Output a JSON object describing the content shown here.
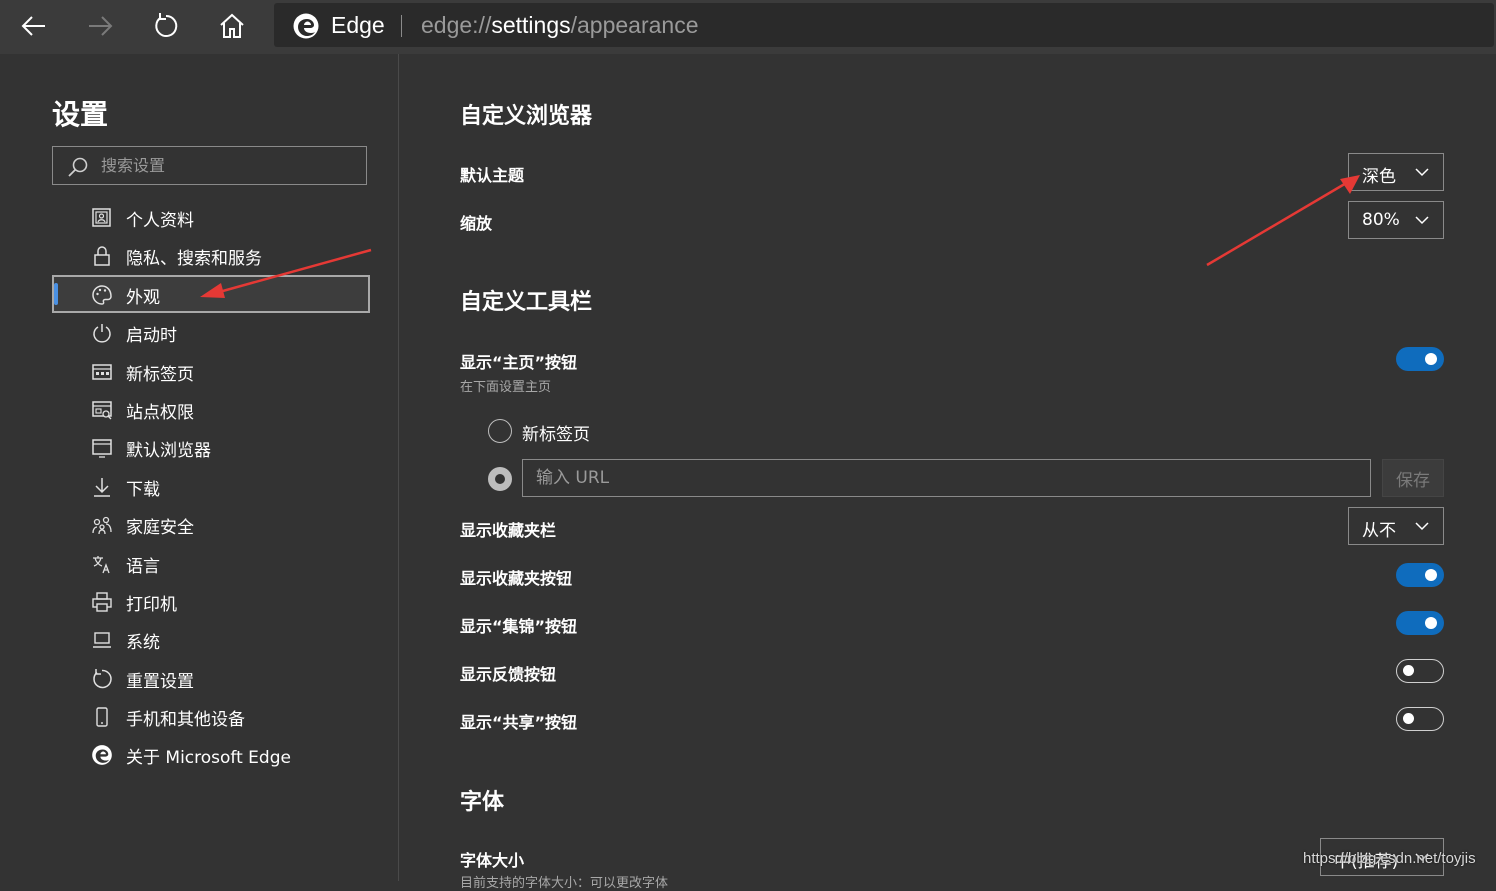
{
  "toolbar": {
    "brand": "Edge",
    "url_prefix": "edge://",
    "url_host": "settings",
    "url_path": "/appearance"
  },
  "sidebar": {
    "title": "设置",
    "search_placeholder": "搜索设置",
    "items": [
      {
        "label": "个人资料",
        "icon": "profile-icon"
      },
      {
        "label": "隐私、搜索和服务",
        "icon": "lock-icon"
      },
      {
        "label": "外观",
        "icon": "palette-icon",
        "active": true
      },
      {
        "label": "启动时",
        "icon": "power-icon"
      },
      {
        "label": "新标签页",
        "icon": "new-tab-icon"
      },
      {
        "label": "站点权限",
        "icon": "site-permissions-icon"
      },
      {
        "label": "默认浏览器",
        "icon": "browser-icon"
      },
      {
        "label": "下载",
        "icon": "download-icon"
      },
      {
        "label": "家庭安全",
        "icon": "family-icon"
      },
      {
        "label": "语言",
        "icon": "language-icon"
      },
      {
        "label": "打印机",
        "icon": "printer-icon"
      },
      {
        "label": "系统",
        "icon": "system-icon"
      },
      {
        "label": "重置设置",
        "icon": "reset-icon"
      },
      {
        "label": "手机和其他设备",
        "icon": "phone-icon"
      },
      {
        "label": "关于 Microsoft Edge",
        "icon": "edge-logo-icon"
      }
    ]
  },
  "main": {
    "customize_browser": {
      "heading": "自定义浏览器",
      "theme_label": "默认主题",
      "theme_value": "深色",
      "zoom_label": "缩放",
      "zoom_value": "80%"
    },
    "customize_toolbar": {
      "heading": "自定义工具栏",
      "home_button_label": "显示“主页”按钮",
      "home_button_sub": "在下面设置主页",
      "home_button_on": true,
      "radio_new_tab": "新标签页",
      "url_placeholder": "输入 URL",
      "save_label": "保存",
      "favorites_bar_label": "显示收藏夹栏",
      "favorites_bar_value": "从不",
      "favorites_button_label": "显示收藏夹按钮",
      "favorites_button_on": true,
      "collections_button_label": "显示“集锦”按钮",
      "collections_button_on": true,
      "feedback_button_label": "显示反馈按钮",
      "feedback_button_on": false,
      "share_button_label": "显示“共享”按钮",
      "share_button_on": false
    },
    "fonts": {
      "heading": "字体",
      "font_size_label": "字体大小",
      "font_size_value": "中(推荐)",
      "font_size_sub": "目前支持的字体大小：可以更改字体"
    }
  },
  "watermark": "https://blog.csdn.net/toyjis",
  "colors": {
    "background": "#333333",
    "toolbar": "#3b3b3b",
    "accent": "#0f6cbd",
    "annotation_arrow": "#e53935"
  }
}
